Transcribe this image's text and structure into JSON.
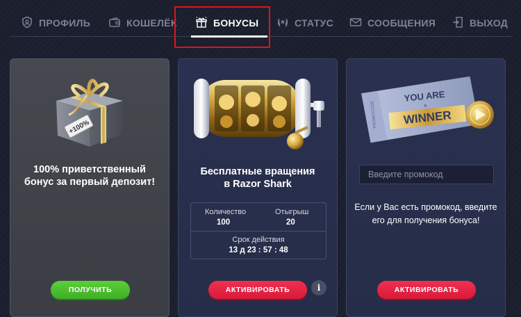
{
  "nav": {
    "items": [
      {
        "label": "ПРОФИЛЬ",
        "icon": "shield-user-icon"
      },
      {
        "label": "КОШЕЛЁК",
        "icon": "wallet-icon"
      },
      {
        "label": "БОНУСЫ",
        "icon": "gift-icon",
        "active": true
      },
      {
        "label": "СТАТУС",
        "icon": "laurel-icon"
      },
      {
        "label": "СООБЩЕНИЯ",
        "icon": "envelope-icon"
      },
      {
        "label": "ВЫХОД",
        "icon": "exit-icon"
      }
    ]
  },
  "cards": {
    "welcome": {
      "badge_text": "+100%",
      "title": "100% приветственный бонус за первый депозит!",
      "button": "ПОЛУЧИТЬ"
    },
    "freespins": {
      "title_line1": "Бесплатные вращения",
      "title_line2": "в Razor Shark",
      "count_label": "Количество",
      "count_value": "100",
      "wager_label": "Отыгрыш",
      "wager_value": "20",
      "expiry_label": "Срок действия",
      "expiry_value": "13 д 23 : 57 : 48",
      "button": "АКТИВИРОВАТЬ",
      "info_icon": "i"
    },
    "promo": {
      "ticket_line1": "YOU ARE",
      "ticket_small": "A",
      "ticket_line2": "WINNER",
      "ticket_side": "PROMOCODE",
      "placeholder": "Введите промокод",
      "text": "Если у Вас есть промокод, введите его для получения бонуса!",
      "button": "АКТИВИРОВАТЬ"
    }
  },
  "colors": {
    "accent_red": "#e0141a",
    "button_green": "#4cc02e",
    "button_red": "#e8254a"
  }
}
